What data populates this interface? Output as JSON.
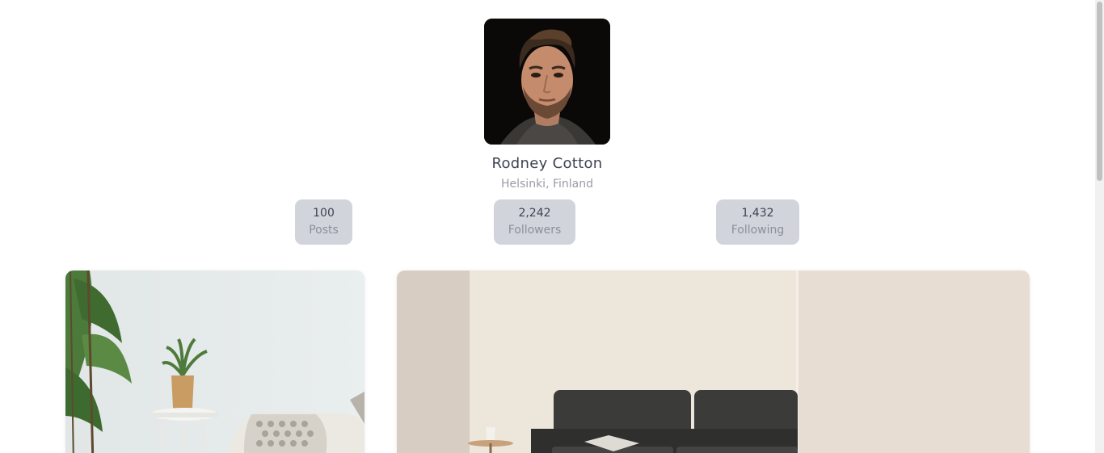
{
  "profile": {
    "name": "Rodney Cotton",
    "location": "Helsinki, Finland",
    "avatar_icon": "profile-photo"
  },
  "stats": [
    {
      "value": "100",
      "label": "Posts"
    },
    {
      "value": "2,242",
      "label": "Followers"
    },
    {
      "value": "1,432",
      "label": "Following"
    }
  ],
  "colors": {
    "stat_bg": "#d2d4dc",
    "name_text": "#3f4352",
    "muted_text": "#9a9ca6"
  }
}
